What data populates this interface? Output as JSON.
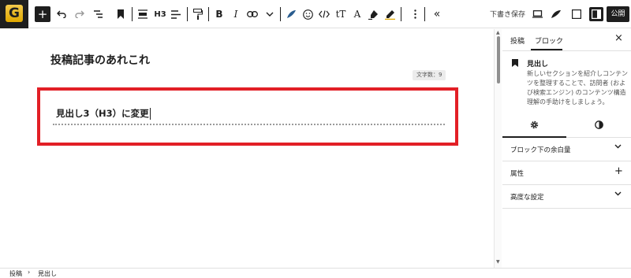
{
  "logo": {
    "letter": "G",
    "name": "swell-logo"
  },
  "toolbar": {
    "add_icon": "plus-icon",
    "heading_level": "H3",
    "save_draft": "下書き保存",
    "publish": "公開",
    "collapse_icon": "«"
  },
  "editor": {
    "post_title": "投稿記事のあれこれ",
    "char_count": "文字数：9",
    "heading_text": "見出し3（H3）に変更"
  },
  "sidebar": {
    "tabs": [
      {
        "label": "投稿"
      },
      {
        "label": "ブロック"
      }
    ],
    "close": "×",
    "block": {
      "name": "見出し",
      "description": "新しいセクションを紹介しコンテンツを整理することで、訪問者 (および検索エンジン) のコンテンツ構造理解の手助けをしましょう。"
    },
    "panels": [
      {
        "label": "ブロック下の余白量"
      },
      {
        "label": "属性",
        "plus": "+"
      },
      {
        "label": "高度な設定"
      }
    ]
  },
  "breadcrumb": {
    "items": [
      "投稿",
      "見出し"
    ],
    "separator": "›"
  },
  "colors": {
    "accent": "#1e1e1e",
    "highlight": "#e21f26",
    "logo": "#e0a800"
  }
}
